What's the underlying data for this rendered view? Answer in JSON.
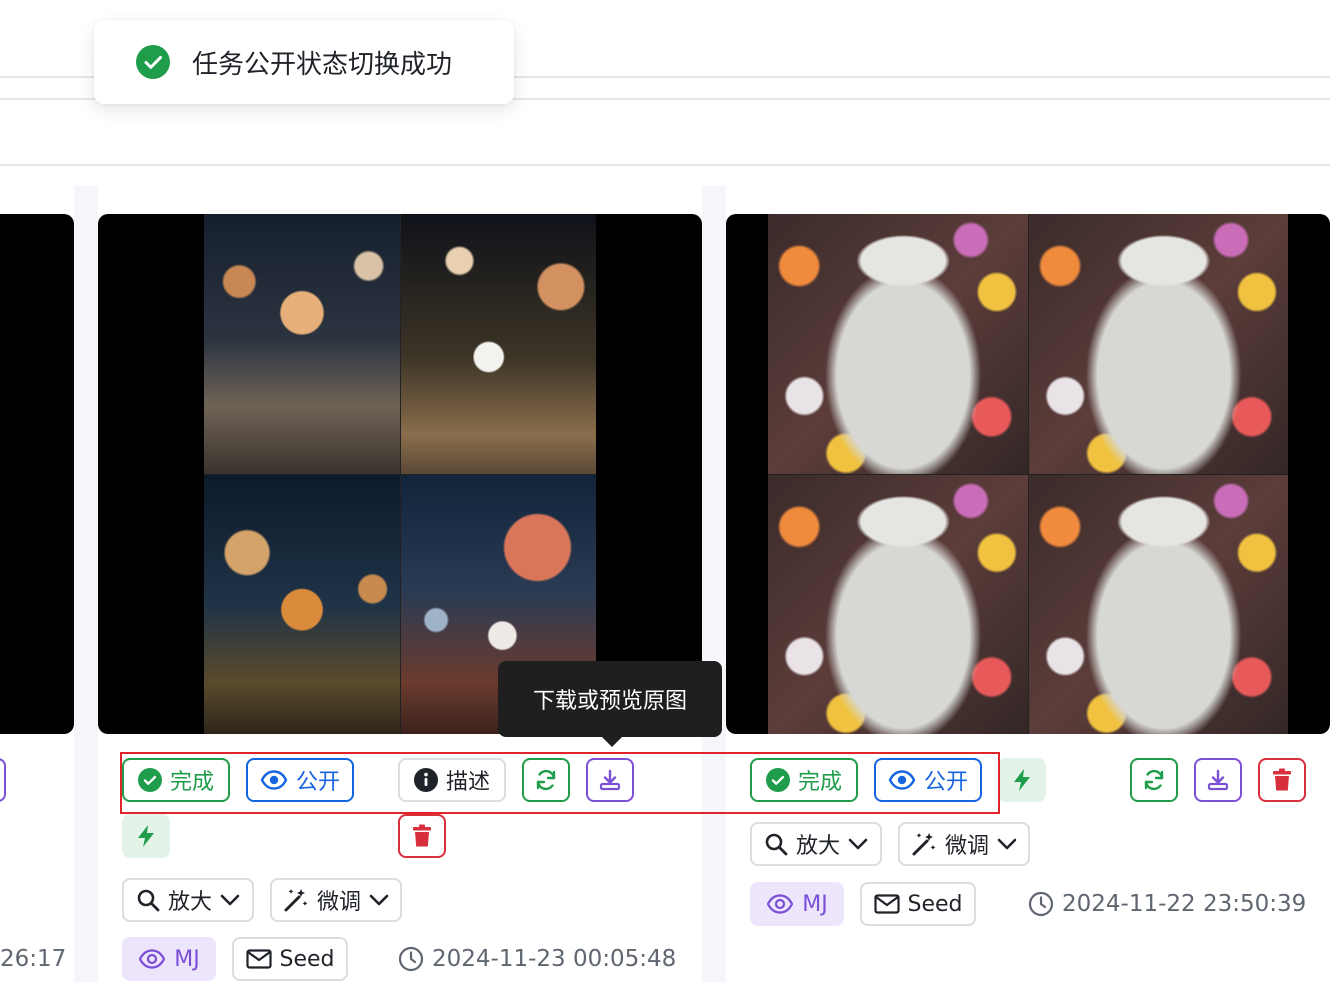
{
  "toast": {
    "message": "任务公开状态切换成功"
  },
  "tooltip": {
    "text": "下载或预览原图"
  },
  "cards": {
    "left": {
      "time_partial": "26:17"
    },
    "middle": {
      "status": "完成",
      "visibility": "公开",
      "describe": "描述",
      "upscale": "放大",
      "vary": "微调",
      "model": "MJ",
      "seed": "Seed",
      "time": "2024-11-23 00:05:48"
    },
    "right": {
      "status": "完成",
      "visibility": "公开",
      "upscale": "放大",
      "vary": "微调",
      "model": "MJ",
      "seed": "Seed",
      "time": "2024-11-22 23:50:39"
    }
  },
  "colors": {
    "success": "#1f9d4a",
    "primary": "#1664e0",
    "purple": "#7b4fd6",
    "danger": "#d92f3c",
    "highlight": "#e0242b"
  }
}
